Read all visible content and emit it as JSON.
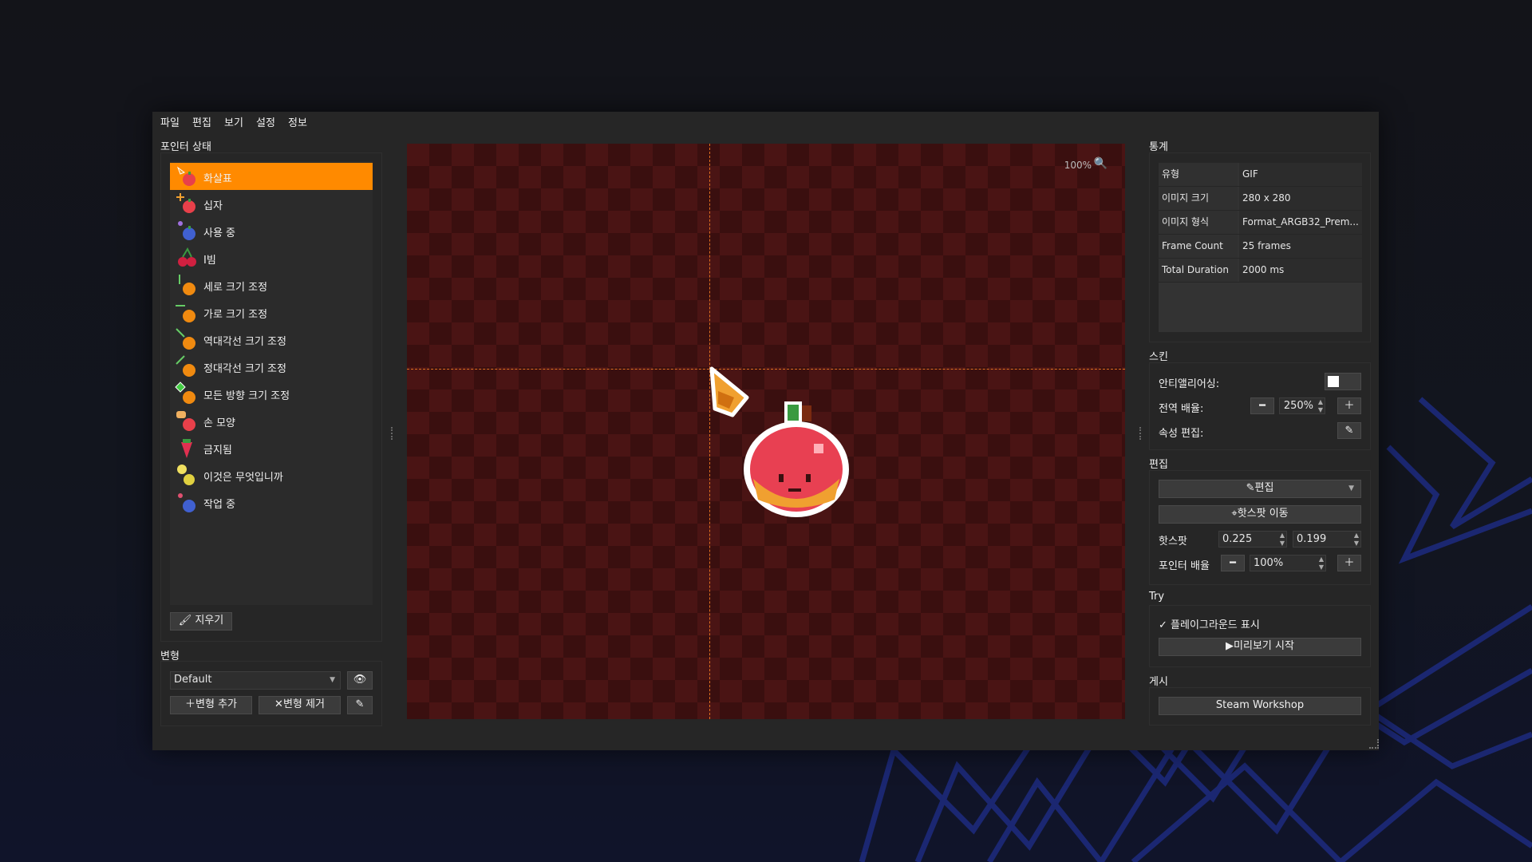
{
  "menu": [
    "파일",
    "편집",
    "보기",
    "설정",
    "정보"
  ],
  "left": {
    "section_title": "포인터 상태",
    "items": [
      "화살표",
      "십자",
      "사용 중",
      "I빔",
      "세로 크기 조정",
      "가로 크기 조정",
      "역대각선 크기 조정",
      "정대각선 크기 조정",
      "모든 방향 크기 조정",
      "손 모양",
      "금지됨",
      "이것은 무엇입니까",
      "작업 중"
    ],
    "selected_index": 0,
    "clear_button": "지우기",
    "variant_title": "변형",
    "variant_value": "Default",
    "add_variant": "변형 추가",
    "remove_variant": "변형 제거"
  },
  "canvas": {
    "zoom": "100%"
  },
  "stats": {
    "title": "통계",
    "rows": [
      {
        "k": "유형",
        "v": "GIF"
      },
      {
        "k": "이미지 크기",
        "v": "280 x 280"
      },
      {
        "k": "이미지 형식",
        "v": "Format_ARGB32_Prem..."
      },
      {
        "k": "Frame Count",
        "v": "25 frames"
      },
      {
        "k": "Total Duration",
        "v": "2000 ms"
      }
    ]
  },
  "skin": {
    "title": "스킨",
    "antialias_label": "안티앨리어싱:",
    "global_scale_label": "전역 배율:",
    "global_scale_value": "250%",
    "props_label": "속성 편집:"
  },
  "edit": {
    "title": "편집",
    "edit_button": "편집",
    "move_hotspot": "핫스팟 이동",
    "hotspot_label": "핫스팟",
    "hotspot_x": "0.225",
    "hotspot_y": "0.199",
    "pointer_scale_label": "포인터 배율",
    "pointer_scale_value": "100%"
  },
  "try": {
    "title": "Try",
    "show_playground": "플레이그라운드 표시",
    "start_preview": "미리보기 시작"
  },
  "publish": {
    "title": "게시",
    "steam": "Steam Workshop"
  },
  "colors": {
    "accent": "#ff8a00",
    "canvas_dark": "#3a0f0f",
    "canvas_light": "#4a1414"
  }
}
